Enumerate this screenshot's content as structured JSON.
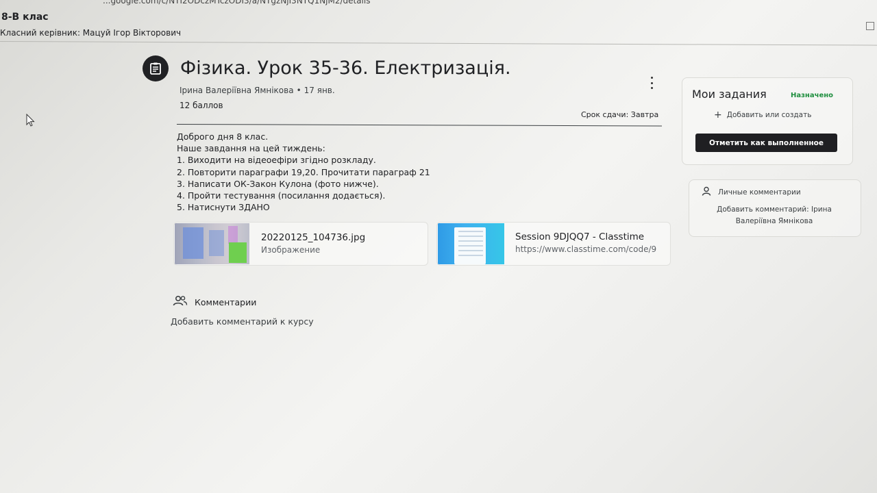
{
  "browser": {
    "url": "...google.com/c/NTI2ODczMTczODI3/a/NTgzNjI3NTQ1NjM2/details"
  },
  "course": {
    "name": "8-В клас",
    "teacher": "Класний керівник: Мацуй Ігор Вікторович"
  },
  "assignment": {
    "title": "Фізика. Урок 35-36. Електризація.",
    "author": "Ірина Валеріївна Ямнікова",
    "date": "17 янв.",
    "points": "12 баллов",
    "due": "Срок сдачи: Завтра",
    "body": [
      "Доброго дня 8 клас.",
      "Наше завдання на цей тиждень:",
      "1. Виходити на відеоефіри згідно розкладу.",
      "2. Повторити параграфи 19,20. Прочитати параграф 21",
      "3. Написати ОК-Закон Кулона (фото нижче).",
      "4. Пройти тестування (посилання додається).",
      "5. Натиснути ЗДАНО"
    ],
    "attachments": [
      {
        "title": "20220125_104736.jpg",
        "subtitle": "Изображение"
      },
      {
        "title": "Session 9DJQQ7 - Classtime",
        "subtitle": "https://www.classtime.com/code/9"
      }
    ]
  },
  "comments": {
    "label": "Комментарии",
    "add": "Добавить комментарий к курсу"
  },
  "my_work": {
    "title": "Мои задания",
    "status": "Назначено",
    "add_label": "Добавить или создать",
    "mark_done": "Отметить как выполненное"
  },
  "private_comments": {
    "label": "Личные комментарии",
    "add_line1": "Добавить комментарий: Ірина",
    "add_line2": "Валеріївна Ямнікова"
  },
  "colors": {
    "status_green": "#1e8e3e",
    "button_dark": "#1f1f22",
    "text": "#202124"
  }
}
